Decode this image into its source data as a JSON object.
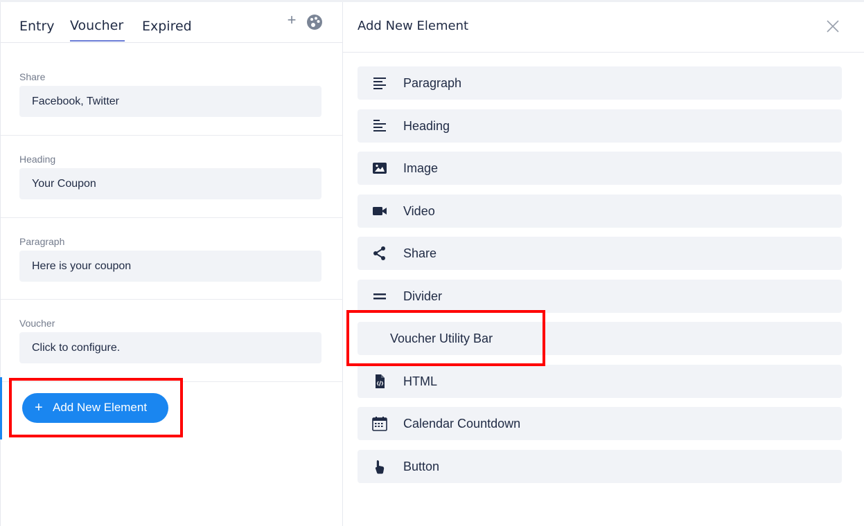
{
  "tabs": {
    "entry": "Entry",
    "voucher": "Voucher",
    "expired": "Expired",
    "add_icon": "plus-icon",
    "theme_icon": "palette-icon"
  },
  "sections": [
    {
      "label": "Share",
      "value": "Facebook, Twitter"
    },
    {
      "label": "Heading",
      "value": "Your Coupon"
    },
    {
      "label": "Paragraph",
      "value": "Here is your coupon"
    },
    {
      "label": "Voucher",
      "value": "Click to configure."
    }
  ],
  "add_button": {
    "label": "Add New Element"
  },
  "dialog": {
    "title": "Add New Element",
    "close_icon": "close-icon",
    "items": [
      {
        "label": "Paragraph",
        "icon": "paragraph-icon"
      },
      {
        "label": "Heading",
        "icon": "heading-icon"
      },
      {
        "label": "Image",
        "icon": "image-icon"
      },
      {
        "label": "Video",
        "icon": "video-icon"
      },
      {
        "label": "Share",
        "icon": "share-icon"
      },
      {
        "label": "Divider",
        "icon": "divider-icon"
      },
      {
        "label": "Voucher Utility Bar",
        "icon": ""
      },
      {
        "label": "HTML",
        "icon": "html-file-icon"
      },
      {
        "label": "Calendar Countdown",
        "icon": "calendar-icon"
      },
      {
        "label": "Button",
        "icon": "pointer-hand-icon"
      }
    ]
  },
  "colors": {
    "accent": "#1a86f0",
    "highlight": "#ff0000",
    "text": "#1f2a44",
    "field_bg": "#f1f3f7"
  }
}
